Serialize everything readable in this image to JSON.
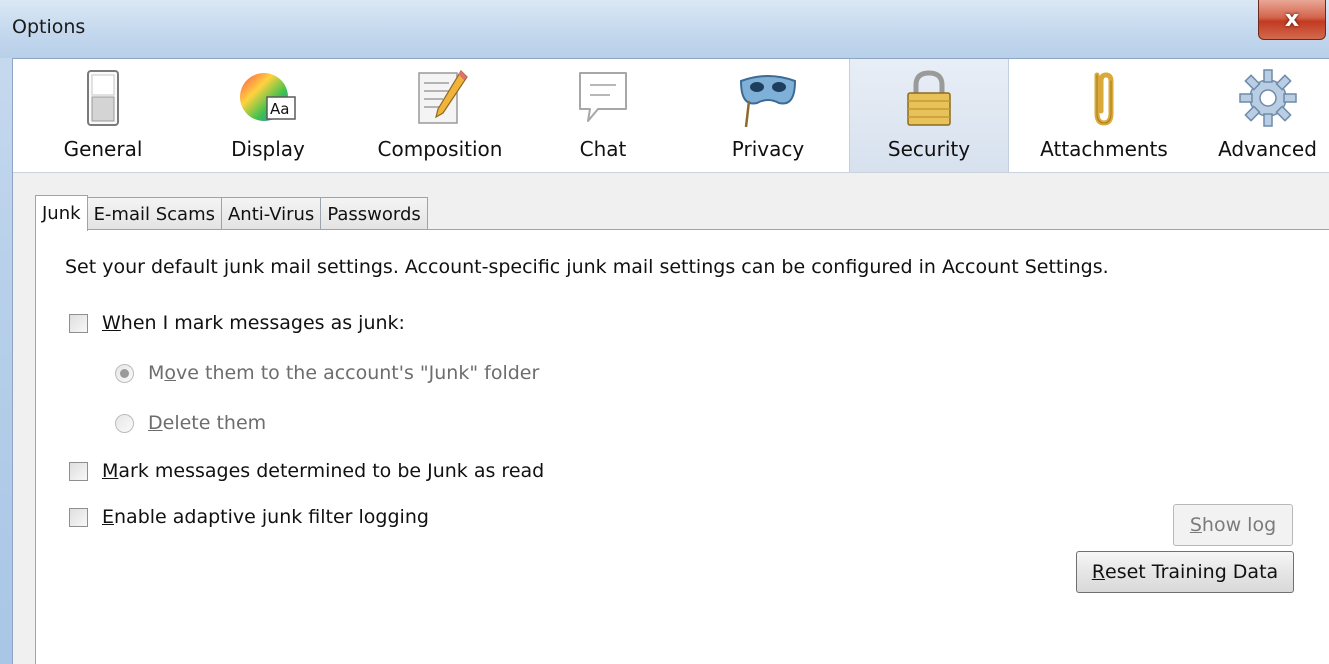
{
  "window": {
    "title": "Options",
    "close_label": "x"
  },
  "toolbar": {
    "panes": [
      {
        "label": "General",
        "icon": "switch-icon"
      },
      {
        "label": "Display",
        "icon": "color-wheel-icon"
      },
      {
        "label": "Composition",
        "icon": "pencil-document-icon"
      },
      {
        "label": "Chat",
        "icon": "speech-bubble-icon"
      },
      {
        "label": "Privacy",
        "icon": "mask-icon"
      },
      {
        "label": "Security",
        "icon": "padlock-icon",
        "selected": true
      },
      {
        "label": "Attachments",
        "icon": "paperclip-icon"
      },
      {
        "label": "Advanced",
        "icon": "gear-icon"
      }
    ]
  },
  "tabs": [
    {
      "label": "Junk",
      "active": true
    },
    {
      "label": "E-mail Scams"
    },
    {
      "label": "Anti-Virus"
    },
    {
      "label": "Passwords"
    }
  ],
  "junk": {
    "description": "Set your default junk mail settings. Account-specific junk mail settings can be configured in Account Settings.",
    "mark_as_junk": {
      "first": "W",
      "rest": "hen I mark messages as junk:",
      "checked": false
    },
    "move_to_folder": {
      "first": "M",
      "u": "o",
      "rest": "ve them to the account's \"Junk\" folder",
      "selected": true
    },
    "delete_them": {
      "u": "D",
      "rest": "elete them",
      "selected": false
    },
    "mark_read": {
      "u": "M",
      "rest": "ark messages determined to be Junk as read",
      "checked": false
    },
    "adaptive_logging": {
      "u": "E",
      "rest": "nable adaptive junk filter logging",
      "checked": false
    },
    "show_log": {
      "u": "S",
      "rest": "how log",
      "enabled": false
    },
    "reset_training": {
      "u": "R",
      "rest": "eset Training Data"
    }
  },
  "colors": {
    "accent_selected_pane": "#d7e1ee",
    "close_button": "#c23a22"
  }
}
